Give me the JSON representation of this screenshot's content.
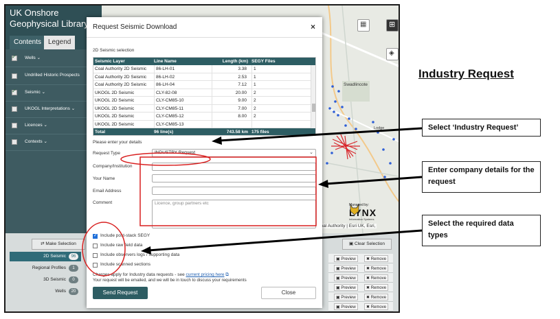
{
  "app": {
    "title": "UK Onshore\nGeophysical Library",
    "tabs": [
      "Contents",
      "Legend"
    ]
  },
  "layers": [
    {
      "label": "Wells",
      "checked": true,
      "chevron": true
    },
    {
      "label": "Undrilled Historic Prospects",
      "checked": false,
      "chevron": false
    },
    {
      "label": "Seismic",
      "checked": true,
      "chevron": true
    },
    {
      "label": "UKOGL Interpretations",
      "checked": false,
      "chevron": true
    },
    {
      "label": "Licences",
      "checked": false,
      "chevron": true
    },
    {
      "label": "Contexts",
      "checked": false,
      "chevron": true
    }
  ],
  "map": {
    "place_labels": [
      "Swadlincote",
      "Lodge"
    ],
    "attribution": "Coal Authority | Esri UK, Esri,",
    "lynx": {
      "managed": "Managed by:",
      "name": "LYNX",
      "sub": "Information Systems"
    }
  },
  "bottom": {
    "make_selection": "Make Selection",
    "clear_selection": "Clear Selection",
    "selections": [
      {
        "label": "2D Seismic",
        "count": "96",
        "active": true
      },
      {
        "label": "Regional Profiles",
        "count": "1",
        "active": false
      },
      {
        "label": "3D Seismic",
        "count": "0",
        "active": false
      },
      {
        "label": "Wells",
        "count": "20",
        "active": false
      }
    ],
    "row_buttons": {
      "preview": "Preview",
      "remove": "Remove"
    }
  },
  "modal": {
    "title": "Request Seismic Download",
    "close_glyph": "×",
    "section_label": "2D Seismic selection",
    "table": {
      "headers": [
        "Seismic Layer",
        "Line Name",
        "Length (km)",
        "SEGY Files"
      ],
      "rows": [
        [
          "Coal Authority 2D Seismic",
          "86-LH-01",
          "3.38",
          "1"
        ],
        [
          "Coal Authority 2D Seismic",
          "86-LH-02",
          "2.53",
          "1"
        ],
        [
          "Coal Authority 2D Seismic",
          "86-LH-04",
          "7.12",
          "1"
        ],
        [
          "UKOGL 2D Seismic",
          "CLY-82-08",
          "20.00",
          "2"
        ],
        [
          "UKOGL 2D Seismic",
          "CLY-CM85-10",
          "9.00",
          "2"
        ],
        [
          "UKOGL 2D Seismic",
          "CLY-CM85-11",
          "7.00",
          "2"
        ],
        [
          "UKOGL 2D Seismic",
          "CLY-CM85-12",
          "8.00",
          "2"
        ],
        [
          "UKOGL 2D Seismic",
          "CLY-CM85-13",
          "",
          ""
        ]
      ],
      "footer": [
        "Total",
        "96 line(s)",
        "743.58 km",
        "175 files"
      ]
    },
    "details_prompt": "Please enter your details",
    "request_type_label": "Request Type",
    "request_type_value": "INDUSTRY Request",
    "company_label": "Company/Institution",
    "name_label": "Your Name",
    "email_label": "Email Address",
    "comment_label": "Comment",
    "comment_placeholder": "Licence, group partners etc",
    "checkboxes": [
      {
        "label": "Include post-stack SEGY",
        "checked": true
      },
      {
        "label": "Include raw field data",
        "checked": false
      },
      {
        "label": "Include observers logs / supporting data",
        "checked": false
      },
      {
        "label": "Include scanned sections",
        "checked": false
      }
    ],
    "charges_text": "Charges apply for Industry data requests - see ",
    "pricing_link": "current pricing here",
    "email_note": "Your request will be emailed, and we will be in touch to discuss your requirements",
    "send_label": "Send Request",
    "close_label": "Close"
  },
  "annotations": {
    "heading": "Industry Request",
    "callouts": [
      "Select ‘Industry Request’",
      "Enter company details for the request",
      "Select  the required data types"
    ],
    "color": "#d81f1f"
  }
}
